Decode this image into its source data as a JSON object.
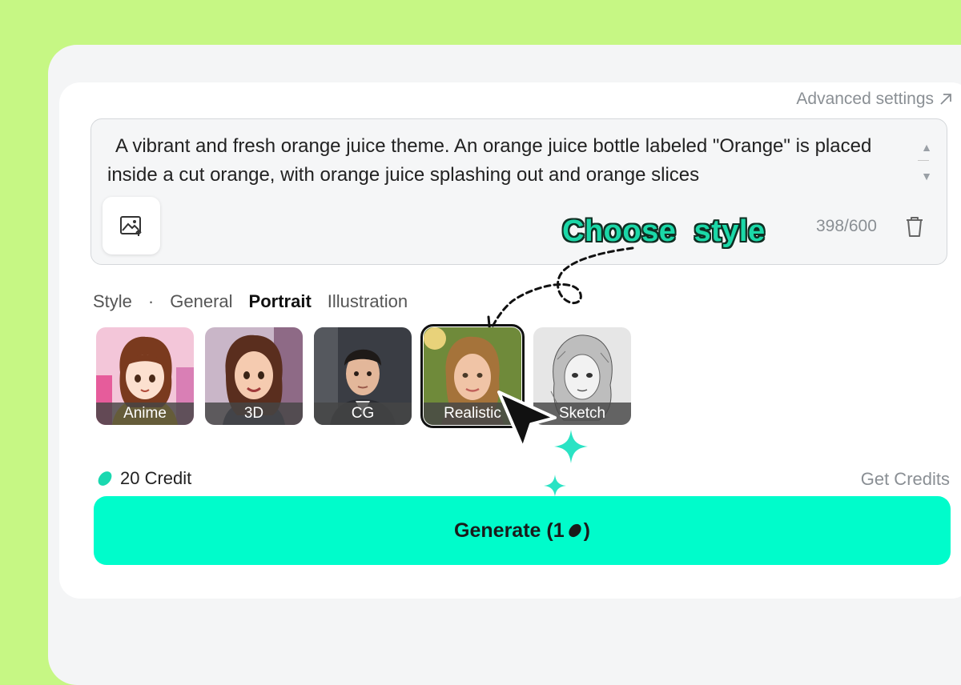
{
  "header": {
    "advanced_settings": "Advanced settings",
    "advanced_icon": "arrow-up-right-icon"
  },
  "prompt": {
    "text": "A vibrant and fresh orange juice theme. An orange juice bottle labeled \"Orange\" is placed inside a cut orange, with orange juice splashing out and orange slices",
    "counter": "398/600"
  },
  "annotation": {
    "callout": "Choose  style"
  },
  "style_row": {
    "label": "Style",
    "separator": "·",
    "tabs": [
      {
        "label": "General",
        "active": false
      },
      {
        "label": "Portrait",
        "active": true
      },
      {
        "label": "Illustration",
        "active": false
      }
    ],
    "thumbnails": [
      {
        "label": "Anime",
        "selected": false
      },
      {
        "label": "3D",
        "selected": false
      },
      {
        "label": "CG",
        "selected": false
      },
      {
        "label": "Realistic",
        "selected": true
      },
      {
        "label": "Sketch",
        "selected": false
      }
    ]
  },
  "credits": {
    "balance": "20 Credit",
    "get_credits": "Get Credits"
  },
  "generate": {
    "label": "Generate (1",
    "label_end": ")"
  },
  "colors": {
    "background": "#c6f784",
    "accent": "#00fccb",
    "callout": "#1bd8a8"
  }
}
